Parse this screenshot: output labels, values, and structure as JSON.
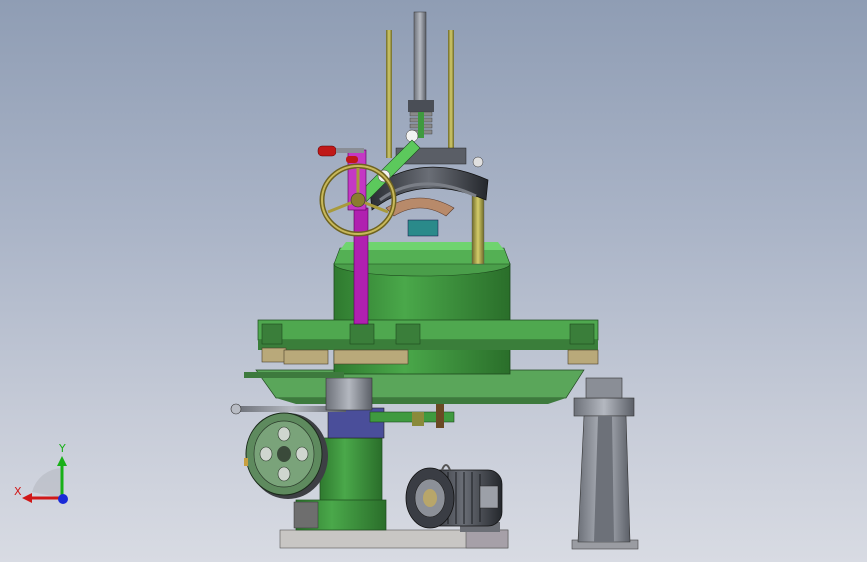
{
  "triad": {
    "x_label": "X",
    "y_label": "Y",
    "x_color": "#d01818",
    "y_color": "#18b018",
    "z_color": "#1a2ad8"
  },
  "model": {
    "icon": "machine-3d-model-icon",
    "colors": {
      "body_green": "#3f9a3f",
      "light_green": "#5cc95c",
      "magenta": "#b020b0",
      "olive": "#a89a3c",
      "tan": "#b9a97a",
      "steel": "#8a8e96",
      "dark_steel": "#4a4e56",
      "red_handle": "#c01818"
    }
  }
}
